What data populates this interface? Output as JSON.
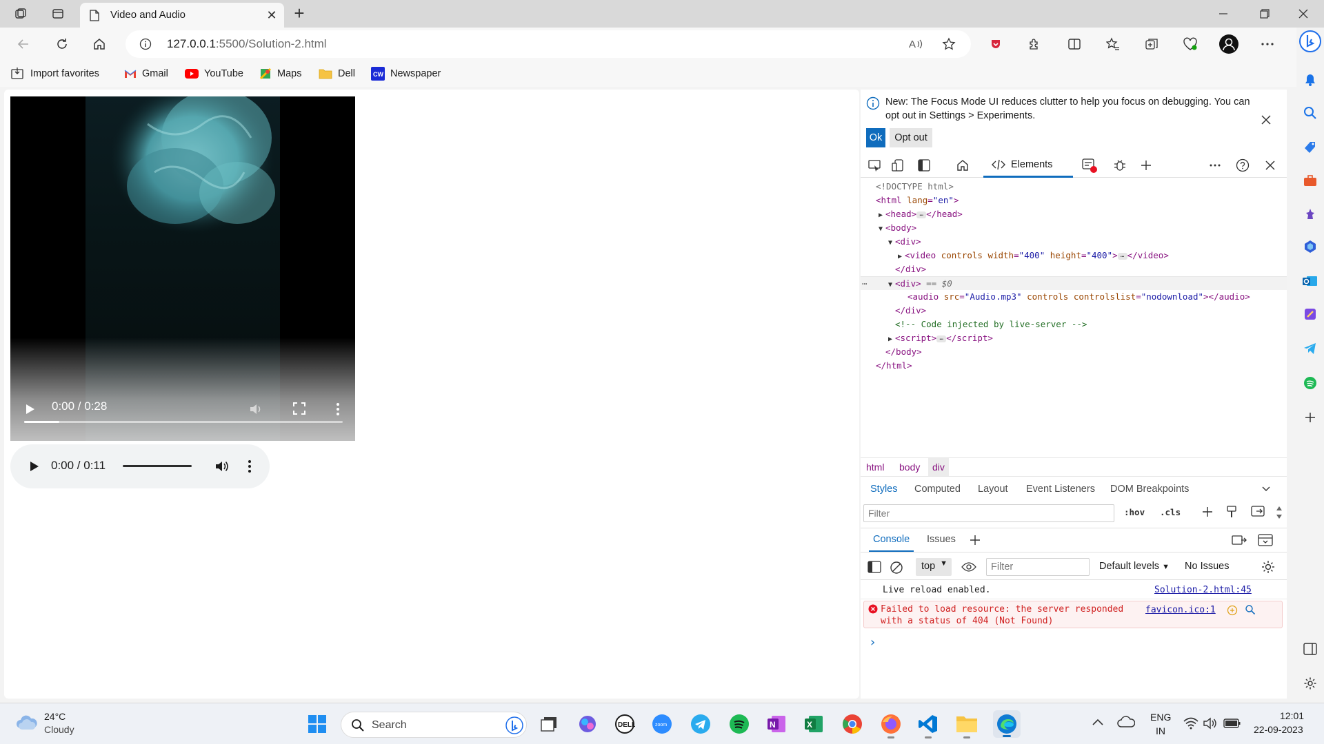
{
  "browser": {
    "tab_title": "Video and Audio",
    "tab_close": "✕",
    "new_tab": "+",
    "url_host": "127.0.0.1",
    "url_rest": ":5500/Solution-2.html"
  },
  "favorites": [
    {
      "label": "Import favorites",
      "icon": "import-icon"
    },
    {
      "label": "Gmail",
      "icon": "gmail-icon"
    },
    {
      "label": "YouTube",
      "icon": "youtube-icon"
    },
    {
      "label": "Maps",
      "icon": "maps-icon"
    },
    {
      "label": "Dell",
      "icon": "folder-icon"
    },
    {
      "label": "Newspaper",
      "icon": "cw-icon"
    }
  ],
  "video": {
    "time": "0:00 / 0:28",
    "progress_fraction": 0.11
  },
  "audio": {
    "time": "0:00 / 0:11"
  },
  "devtools": {
    "info_text": "New: The Focus Mode UI reduces clutter to help you focus on debugging. You can opt out in Settings > Experiments.",
    "ok": "Ok",
    "opt_out": "Opt out",
    "elements_tab": "Elements",
    "breadcrumb": [
      "html",
      "body",
      "div"
    ],
    "styles_tabs": [
      "Styles",
      "Computed",
      "Layout",
      "Event Listeners",
      "DOM Breakpoints"
    ],
    "styles_filter_placeholder": "Filter",
    "hov": ":hov",
    "cls": ".cls",
    "drawer_tabs": [
      "Console",
      "Issues"
    ],
    "console": {
      "context": "top",
      "filter_placeholder": "Filter",
      "levels": "Default levels",
      "issues": "No Issues",
      "log_text": "Live reload enabled.",
      "log_source": "Solution-2.html:45",
      "error_text_1": "Failed to load resource: the server responded",
      "error_text_2": "with a status of 404 (Not Found)",
      "error_source": "favicon.ico:1",
      "prompt": "›"
    }
  },
  "taskbar": {
    "weather_temp": "24°C",
    "weather_desc": "Cloudy",
    "search": "Search",
    "lang_1": "ENG",
    "lang_2": "IN",
    "time": "12:01",
    "date": "22-09-2023"
  }
}
